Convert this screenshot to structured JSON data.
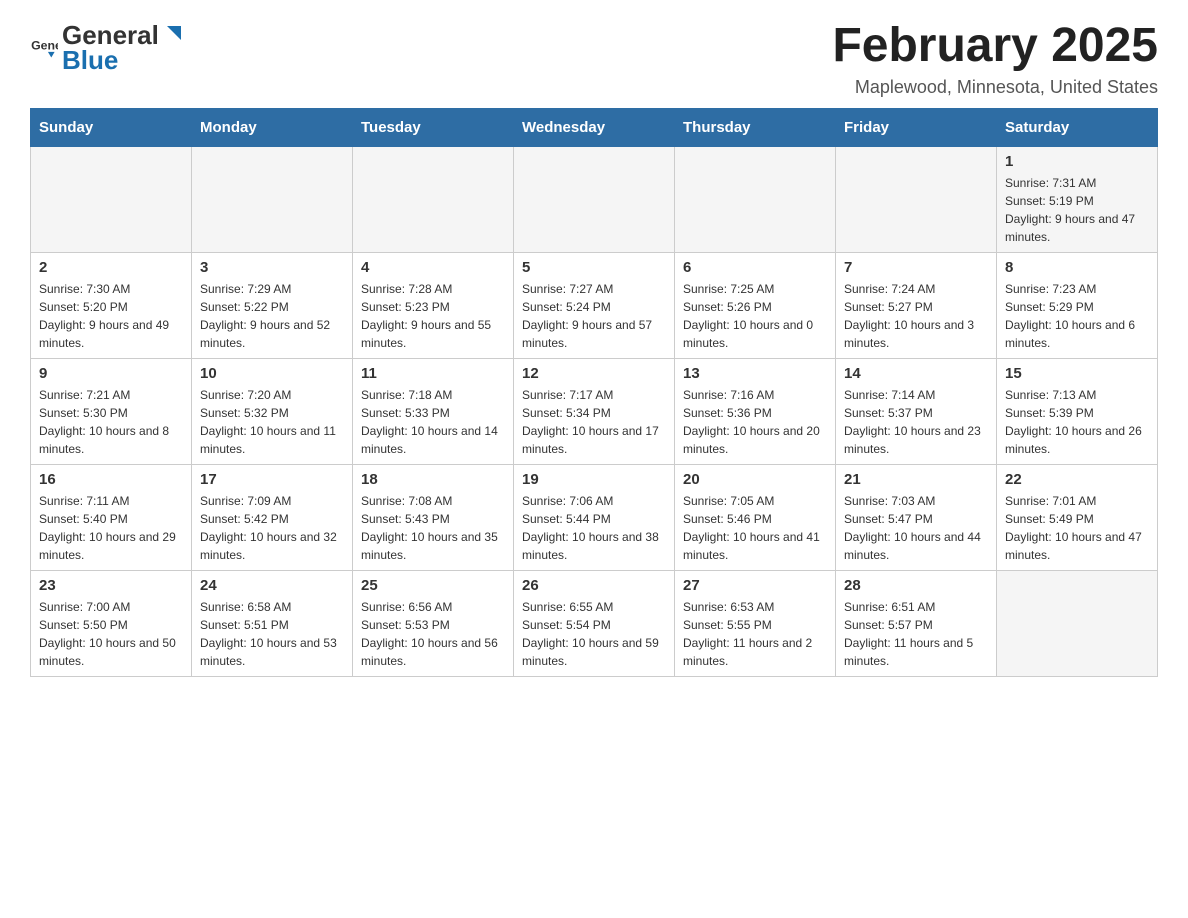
{
  "header": {
    "logo_general": "General",
    "logo_blue": "Blue",
    "month_title": "February 2025",
    "location": "Maplewood, Minnesota, United States"
  },
  "days_of_week": [
    "Sunday",
    "Monday",
    "Tuesday",
    "Wednesday",
    "Thursday",
    "Friday",
    "Saturday"
  ],
  "weeks": [
    {
      "days": [
        {
          "num": "",
          "info": ""
        },
        {
          "num": "",
          "info": ""
        },
        {
          "num": "",
          "info": ""
        },
        {
          "num": "",
          "info": ""
        },
        {
          "num": "",
          "info": ""
        },
        {
          "num": "",
          "info": ""
        },
        {
          "num": "1",
          "info": "Sunrise: 7:31 AM\nSunset: 5:19 PM\nDaylight: 9 hours and 47 minutes."
        }
      ]
    },
    {
      "days": [
        {
          "num": "2",
          "info": "Sunrise: 7:30 AM\nSunset: 5:20 PM\nDaylight: 9 hours and 49 minutes."
        },
        {
          "num": "3",
          "info": "Sunrise: 7:29 AM\nSunset: 5:22 PM\nDaylight: 9 hours and 52 minutes."
        },
        {
          "num": "4",
          "info": "Sunrise: 7:28 AM\nSunset: 5:23 PM\nDaylight: 9 hours and 55 minutes."
        },
        {
          "num": "5",
          "info": "Sunrise: 7:27 AM\nSunset: 5:24 PM\nDaylight: 9 hours and 57 minutes."
        },
        {
          "num": "6",
          "info": "Sunrise: 7:25 AM\nSunset: 5:26 PM\nDaylight: 10 hours and 0 minutes."
        },
        {
          "num": "7",
          "info": "Sunrise: 7:24 AM\nSunset: 5:27 PM\nDaylight: 10 hours and 3 minutes."
        },
        {
          "num": "8",
          "info": "Sunrise: 7:23 AM\nSunset: 5:29 PM\nDaylight: 10 hours and 6 minutes."
        }
      ]
    },
    {
      "days": [
        {
          "num": "9",
          "info": "Sunrise: 7:21 AM\nSunset: 5:30 PM\nDaylight: 10 hours and 8 minutes."
        },
        {
          "num": "10",
          "info": "Sunrise: 7:20 AM\nSunset: 5:32 PM\nDaylight: 10 hours and 11 minutes."
        },
        {
          "num": "11",
          "info": "Sunrise: 7:18 AM\nSunset: 5:33 PM\nDaylight: 10 hours and 14 minutes."
        },
        {
          "num": "12",
          "info": "Sunrise: 7:17 AM\nSunset: 5:34 PM\nDaylight: 10 hours and 17 minutes."
        },
        {
          "num": "13",
          "info": "Sunrise: 7:16 AM\nSunset: 5:36 PM\nDaylight: 10 hours and 20 minutes."
        },
        {
          "num": "14",
          "info": "Sunrise: 7:14 AM\nSunset: 5:37 PM\nDaylight: 10 hours and 23 minutes."
        },
        {
          "num": "15",
          "info": "Sunrise: 7:13 AM\nSunset: 5:39 PM\nDaylight: 10 hours and 26 minutes."
        }
      ]
    },
    {
      "days": [
        {
          "num": "16",
          "info": "Sunrise: 7:11 AM\nSunset: 5:40 PM\nDaylight: 10 hours and 29 minutes."
        },
        {
          "num": "17",
          "info": "Sunrise: 7:09 AM\nSunset: 5:42 PM\nDaylight: 10 hours and 32 minutes."
        },
        {
          "num": "18",
          "info": "Sunrise: 7:08 AM\nSunset: 5:43 PM\nDaylight: 10 hours and 35 minutes."
        },
        {
          "num": "19",
          "info": "Sunrise: 7:06 AM\nSunset: 5:44 PM\nDaylight: 10 hours and 38 minutes."
        },
        {
          "num": "20",
          "info": "Sunrise: 7:05 AM\nSunset: 5:46 PM\nDaylight: 10 hours and 41 minutes."
        },
        {
          "num": "21",
          "info": "Sunrise: 7:03 AM\nSunset: 5:47 PM\nDaylight: 10 hours and 44 minutes."
        },
        {
          "num": "22",
          "info": "Sunrise: 7:01 AM\nSunset: 5:49 PM\nDaylight: 10 hours and 47 minutes."
        }
      ]
    },
    {
      "days": [
        {
          "num": "23",
          "info": "Sunrise: 7:00 AM\nSunset: 5:50 PM\nDaylight: 10 hours and 50 minutes."
        },
        {
          "num": "24",
          "info": "Sunrise: 6:58 AM\nSunset: 5:51 PM\nDaylight: 10 hours and 53 minutes."
        },
        {
          "num": "25",
          "info": "Sunrise: 6:56 AM\nSunset: 5:53 PM\nDaylight: 10 hours and 56 minutes."
        },
        {
          "num": "26",
          "info": "Sunrise: 6:55 AM\nSunset: 5:54 PM\nDaylight: 10 hours and 59 minutes."
        },
        {
          "num": "27",
          "info": "Sunrise: 6:53 AM\nSunset: 5:55 PM\nDaylight: 11 hours and 2 minutes."
        },
        {
          "num": "28",
          "info": "Sunrise: 6:51 AM\nSunset: 5:57 PM\nDaylight: 11 hours and 5 minutes."
        },
        {
          "num": "",
          "info": ""
        }
      ]
    }
  ]
}
